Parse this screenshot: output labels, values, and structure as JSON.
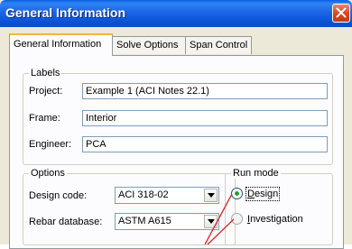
{
  "window": {
    "title": "General Information"
  },
  "tabs": [
    {
      "label": "General Information"
    },
    {
      "label": "Solve Options"
    },
    {
      "label": "Span Control"
    }
  ],
  "labels_group": {
    "title": "Labels",
    "project_label": "Project:",
    "project_value": "Example 1 (ACI Notes 22.1)",
    "frame_label": "Frame:",
    "frame_value": "Interior",
    "engineer_label": "Engineer:",
    "engineer_value": "PCA"
  },
  "options_group": {
    "title": "Options",
    "design_code_label": "Design code:",
    "design_code_value": "ACI 318-02",
    "rebar_label": "Rebar database:",
    "rebar_value": "ASTM A615"
  },
  "run_mode": {
    "title": "Run mode",
    "design": "Design",
    "design_underline": "D",
    "design_rest": "esign",
    "investigation_underline": "I",
    "investigation_rest": "nvestigation",
    "selected": "Design"
  },
  "icons": {
    "close": "close-x-icon",
    "dropdown": "chevron-down-icon"
  },
  "colors": {
    "titlebar": "#0a5ee0",
    "close": "#d5451d",
    "annotation": "#e02020",
    "tab_highlight": "#f2b838"
  }
}
